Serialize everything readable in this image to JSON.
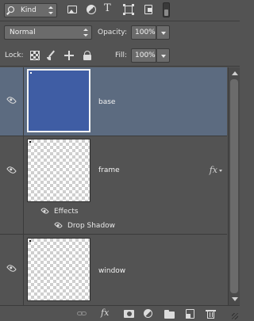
{
  "filter_bar": {
    "kind_label": "Kind",
    "icons": [
      "image-filter-icon",
      "adjustment-filter-icon",
      "type-filter-icon",
      "shape-filter-icon",
      "smart-object-filter-icon",
      "filter-toggle"
    ],
    "type_glyph": "T"
  },
  "blend": {
    "mode": "Normal",
    "opacity_label": "Opacity:",
    "opacity_value": "100%"
  },
  "lock": {
    "label": "Lock:",
    "fill_label": "Fill:",
    "fill_value": "100%"
  },
  "layers": [
    {
      "name": "base",
      "selected": true,
      "visible": true,
      "thumbnail": "solid",
      "thumbnail_color": "#3f5da4",
      "has_fx": false
    },
    {
      "name": "frame",
      "selected": false,
      "visible": true,
      "thumbnail": "transparent",
      "has_fx": true,
      "fx_badge": "fx",
      "effects_label": "Effects",
      "effects": [
        "Drop Shadow"
      ]
    },
    {
      "name": "window",
      "selected": false,
      "visible": true,
      "thumbnail": "transparent",
      "has_fx": false
    }
  ],
  "bottom_bar": {
    "fx_label": "fx",
    "icons": [
      "link-layers-icon",
      "fx-icon",
      "add-mask-icon",
      "new-adjustment-icon",
      "new-group-icon",
      "new-layer-icon",
      "trash-icon"
    ]
  },
  "colors": {
    "panel_bg": "#535353",
    "selected_row": "#5c6b80",
    "base_fill": "#3f5da4"
  }
}
